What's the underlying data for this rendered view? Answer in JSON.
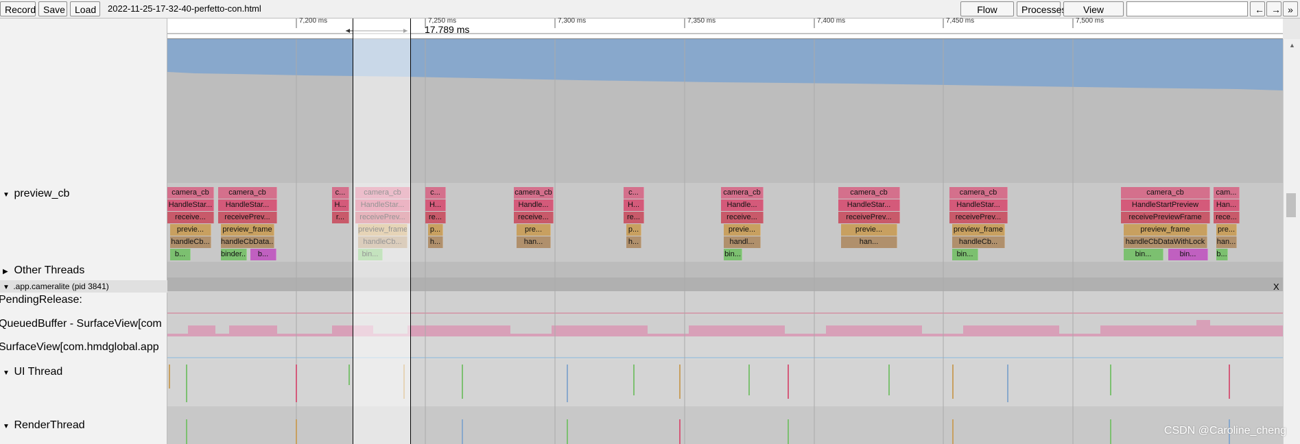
{
  "toolbar": {
    "record_label": "Record",
    "save_label": "Save",
    "load_label": "Load",
    "file_title": "2022-11-25-17-32-40-perfetto-con.html",
    "flow_events_label": "Flow events",
    "processes_label": "Processes",
    "view_options_label": "View Options",
    "nav_back": "←",
    "nav_forward": "→",
    "more": "»"
  },
  "ruler": {
    "ticks": [
      "7,200 ms",
      "7,250 ms",
      "7,300 ms",
      "7,350 ms",
      "7,400 ms",
      "7,450 ms",
      "7,500 ms"
    ],
    "selection_duration": "17.789 ms"
  },
  "tracks": {
    "preview_cb": "preview_cb",
    "other_threads": "Other Threads",
    "process": ".app.cameralite (pid 3841)",
    "process_close": "X",
    "pending_release": "PendingRelease:",
    "queued_buffer": "QueuedBuffer - SurfaceView[com",
    "surfaceview": "SurfaceView[com.hmdglobal.app",
    "ui_thread": "UI Thread",
    "render_thread": "RenderThread"
  },
  "slice_groups": [
    {
      "labels": [
        "camera_cb",
        "HandleStar...",
        "receive...",
        "previe...",
        "handleCb...",
        "b..."
      ]
    },
    {
      "labels": [
        "camera_cb",
        "HandleStar...",
        "receivePrev...",
        "preview_frame",
        "handleCbData...",
        "binder...",
        "b..."
      ]
    },
    {
      "labels": [
        "c...",
        "H...",
        "r..."
      ]
    },
    {
      "labels": [
        "camera_cb",
        "HandleStar...",
        "receivePrev...",
        "preview_frame",
        "handleCb...",
        "bin..."
      ]
    },
    {
      "labels": [
        "c...",
        "H...",
        "re...",
        "p...",
        "h..."
      ]
    },
    {
      "labels": [
        "camera_cb",
        "Handle...",
        "receive...",
        "pre...",
        "han..."
      ]
    },
    {
      "labels": [
        "c...",
        "H...",
        "re...",
        "p...",
        "h..."
      ]
    },
    {
      "labels": [
        "camera_cb",
        "Handle...",
        "receive...",
        "previe...",
        "handl...",
        "bin..."
      ]
    },
    {
      "labels": [
        "camera_cb",
        "HandleStar...",
        "receivePrev...",
        "previe...",
        "han..."
      ]
    },
    {
      "labels": [
        "camera_cb",
        "HandleStar...",
        "receivePrev...",
        "preview_frame",
        "handleCb...",
        "bin..."
      ]
    },
    {
      "labels": [
        "camera_cb",
        "HandleStartPreview",
        "receivePreviewFrame",
        "preview_frame",
        "handleCbDataWithLock",
        "bin...",
        "bin..."
      ]
    },
    {
      "labels": [
        "cam...",
        "Han...",
        "rece...",
        "pre...",
        "han...",
        "b..."
      ]
    }
  ],
  "watermark": "CSDN @Caroline_cheng",
  "colors": {
    "camera_cb": "#d4708c",
    "handle": "#d45a7a",
    "receive": "#c85a6a",
    "preview_frame": "#c8a060",
    "handlecb": "#b0906c",
    "binder_green": "#7cc070",
    "binder_purple": "#c060c0",
    "memory_blue": "#88a8cc"
  }
}
